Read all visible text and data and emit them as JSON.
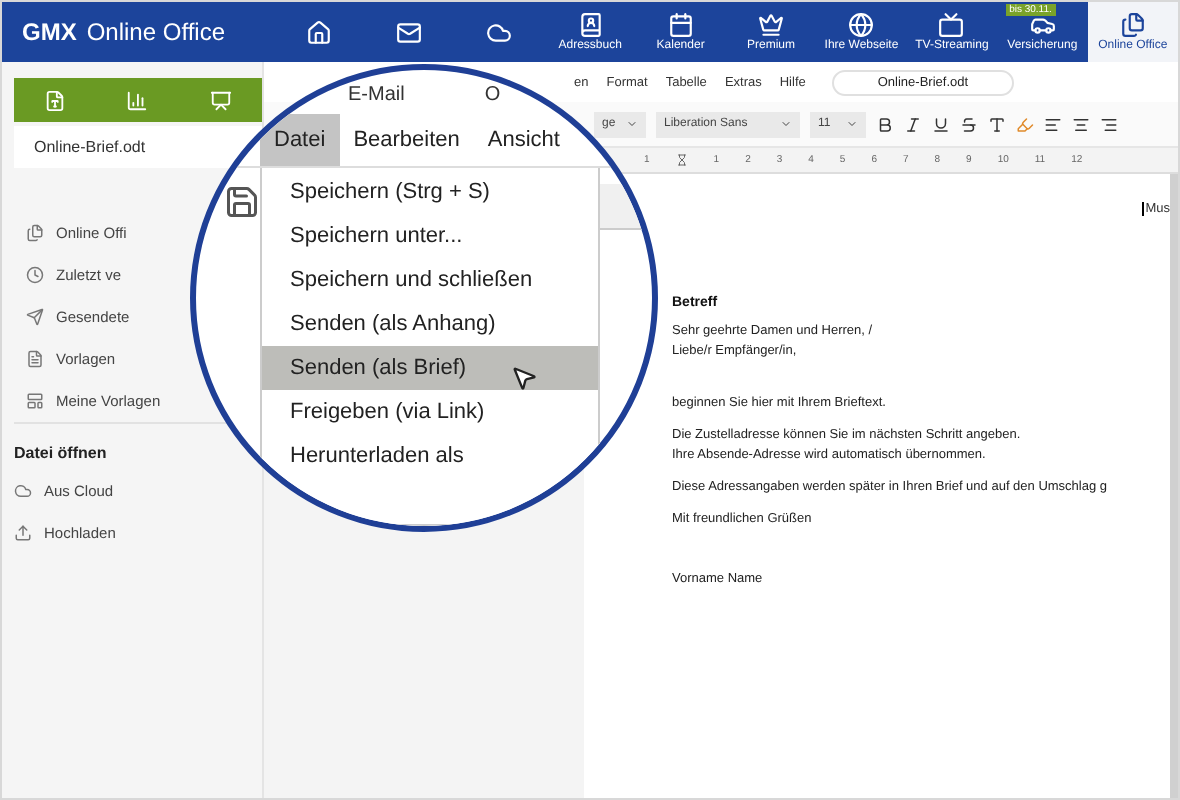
{
  "header": {
    "logo": "GMX",
    "product": "Online Office",
    "nav": [
      {
        "selected": false
      },
      {
        "selected": false
      },
      {
        "selected": false
      },
      {
        "label": "Adressbuch",
        "selected": false
      },
      {
        "label": "Kalender",
        "selected": false
      },
      {
        "label": "Premium",
        "selected": false
      },
      {
        "label": "Ihre Webseite",
        "selected": false
      },
      {
        "label": "TV-Streaming",
        "selected": false
      },
      {
        "label": "Versicherung",
        "badge": "bis 30.11.",
        "selected": false
      },
      {
        "label": "Online Office",
        "selected": true
      }
    ]
  },
  "left_panel": {
    "file_name": "Online-Brief.odt",
    "items": [
      "Online Offi",
      "Zuletzt ve",
      "Gesendete",
      "Vorlagen",
      "Meine Vorlagen"
    ],
    "open_title": "Datei öffnen",
    "open_items": [
      "Aus Cloud",
      "Hochladen"
    ]
  },
  "editor": {
    "menus": [
      "en",
      "Format",
      "Tabelle",
      "Extras",
      "Hilfe"
    ],
    "file_pill": "Online-Brief.odt",
    "style": "ge",
    "font": "Liberation Sans",
    "size": "11",
    "ruler": [
      "1",
      "1",
      "2",
      "3",
      "4",
      "5",
      "6",
      "7",
      "8",
      "9",
      "10",
      "11",
      "12"
    ],
    "document": {
      "margin_cut": "Mus",
      "subject": "Betreff",
      "paragraphs": [
        [
          "Sehr geehrte Damen und Herren, /",
          "Liebe/r Empfänger/in,"
        ],
        [
          "beginnen Sie hier mit Ihrem Brieftext."
        ],
        [
          "Die Zustelladresse können Sie im nächsten Schritt angeben.",
          "Ihre Absende-Adresse wird automatisch übernommen."
        ],
        [
          "Diese Adressangaben werden später in Ihren Brief und auf den Umschlag g"
        ],
        [
          "Mit freundlichen Grüßen"
        ],
        [
          "Vorname Name"
        ]
      ]
    }
  },
  "magnifier": {
    "tab": "E-Mail",
    "tab_cut": "O",
    "menus": [
      {
        "label": "Datei",
        "selected": true
      },
      {
        "label": "Bearbeiten",
        "selected": false
      },
      {
        "label": "Ansicht",
        "selected": false
      }
    ],
    "dropdown": [
      {
        "label": "Speichern (Strg + S)",
        "selected": false
      },
      {
        "label": "Speichern unter...",
        "selected": false
      },
      {
        "label": "Speichern und schließen",
        "selected": false
      },
      {
        "label": "Senden (als Anhang)",
        "selected": false
      },
      {
        "label": "Senden (als Brief)",
        "selected": true
      },
      {
        "label": "Freigeben (via Link)",
        "selected": false
      },
      {
        "label": "Herunterladen als",
        "selected": false
      }
    ]
  }
}
